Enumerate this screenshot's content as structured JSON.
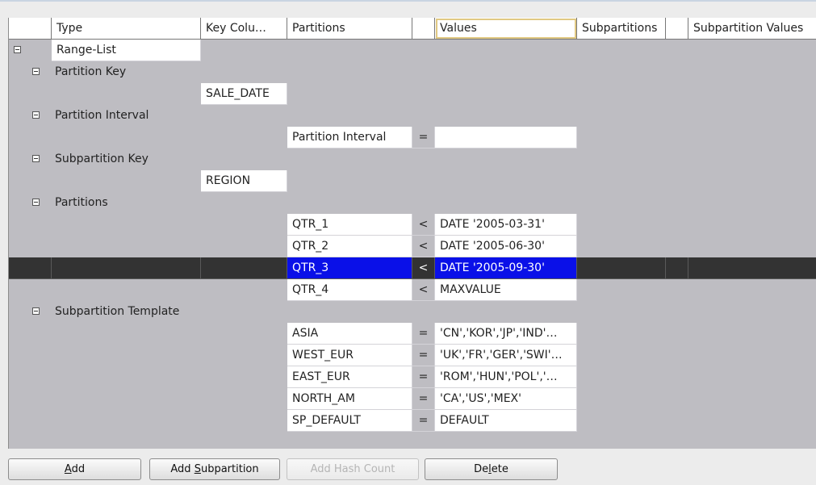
{
  "columns": [
    "Type",
    "Key Colu…",
    "Partitions",
    "",
    "Values",
    "Subpartitions",
    "",
    "Subpartition Values"
  ],
  "tree": {
    "root": "Range-List",
    "partition_key": {
      "label": "Partition Key",
      "column": "SALE_DATE"
    },
    "partition_interval": {
      "label": "Partition Interval",
      "name": "Partition Interval",
      "op": "=",
      "value": ""
    },
    "subpartition_key": {
      "label": "Subpartition Key",
      "column": "REGION"
    },
    "partitions": {
      "label": "Partitions",
      "items": [
        {
          "name": "QTR_1",
          "op": "<",
          "value": "DATE '2005-03-31'"
        },
        {
          "name": "QTR_2",
          "op": "<",
          "value": "DATE '2005-06-30'"
        },
        {
          "name": "QTR_3",
          "op": "<",
          "value": "DATE '2005-09-30'"
        },
        {
          "name": "QTR_4",
          "op": "<",
          "value": "MAXVALUE"
        }
      ]
    },
    "subpartition_template": {
      "label": "Subpartition Template",
      "items": [
        {
          "name": "ASIA",
          "op": "=",
          "value": "'CN','KOR','JP','IND'…"
        },
        {
          "name": "WEST_EUR",
          "op": "=",
          "value": "'UK','FR','GER','SWI'…"
        },
        {
          "name": "EAST_EUR",
          "op": "=",
          "value": "'ROM','HUN','POL','…"
        },
        {
          "name": "NORTH_AM",
          "op": "=",
          "value": "'CA','US','MEX'"
        },
        {
          "name": "SP_DEFAULT",
          "op": "=",
          "value": "DEFAULT"
        }
      ]
    }
  },
  "buttons": {
    "add": {
      "pre": "",
      "mn": "A",
      "post": "dd"
    },
    "add_subpartition": {
      "pre": "Add ",
      "mn": "S",
      "post": "ubpartition"
    },
    "add_hash_count": "Add Hash Count",
    "delete": {
      "pre": "De",
      "mn": "l",
      "post": "ete"
    }
  },
  "colors": {
    "grid_bg": "#bebdc2",
    "selected_row": "#333333",
    "selection_blue": "#0a10e8",
    "focus_outline": "#e1c983"
  }
}
